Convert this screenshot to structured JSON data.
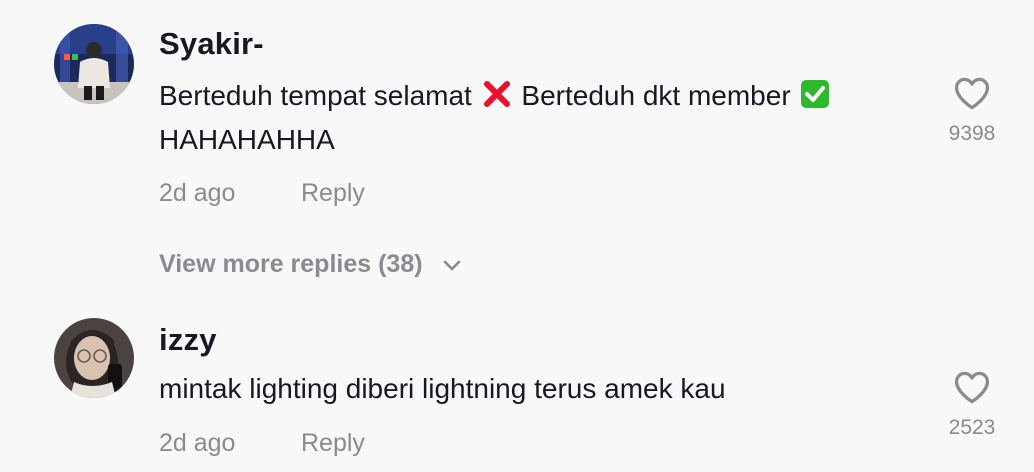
{
  "comments": [
    {
      "username": "Syakir-",
      "text_part1": "Berteduh tempat selamat",
      "text_part2": "Berteduh dkt member",
      "text_line2": "HAHAHAHHA",
      "emoji1": "cross-mark-emoji",
      "emoji2": "check-mark-button-emoji",
      "time": "2d ago",
      "reply_label": "Reply",
      "likes": "9398"
    },
    {
      "username": "izzy",
      "text": "mintak lighting diberi lightning terus amek kau",
      "time": "2d ago",
      "reply_label": "Reply",
      "likes": "2523"
    }
  ],
  "view_more": {
    "label": "View more replies (38)",
    "icon": "chevron-down-icon"
  },
  "colors": {
    "background": "#f8f8f8",
    "primary_text": "#161823",
    "secondary_text": "#8a8b91",
    "cross_red": "#e8112d",
    "check_green": "#2eb82e"
  }
}
